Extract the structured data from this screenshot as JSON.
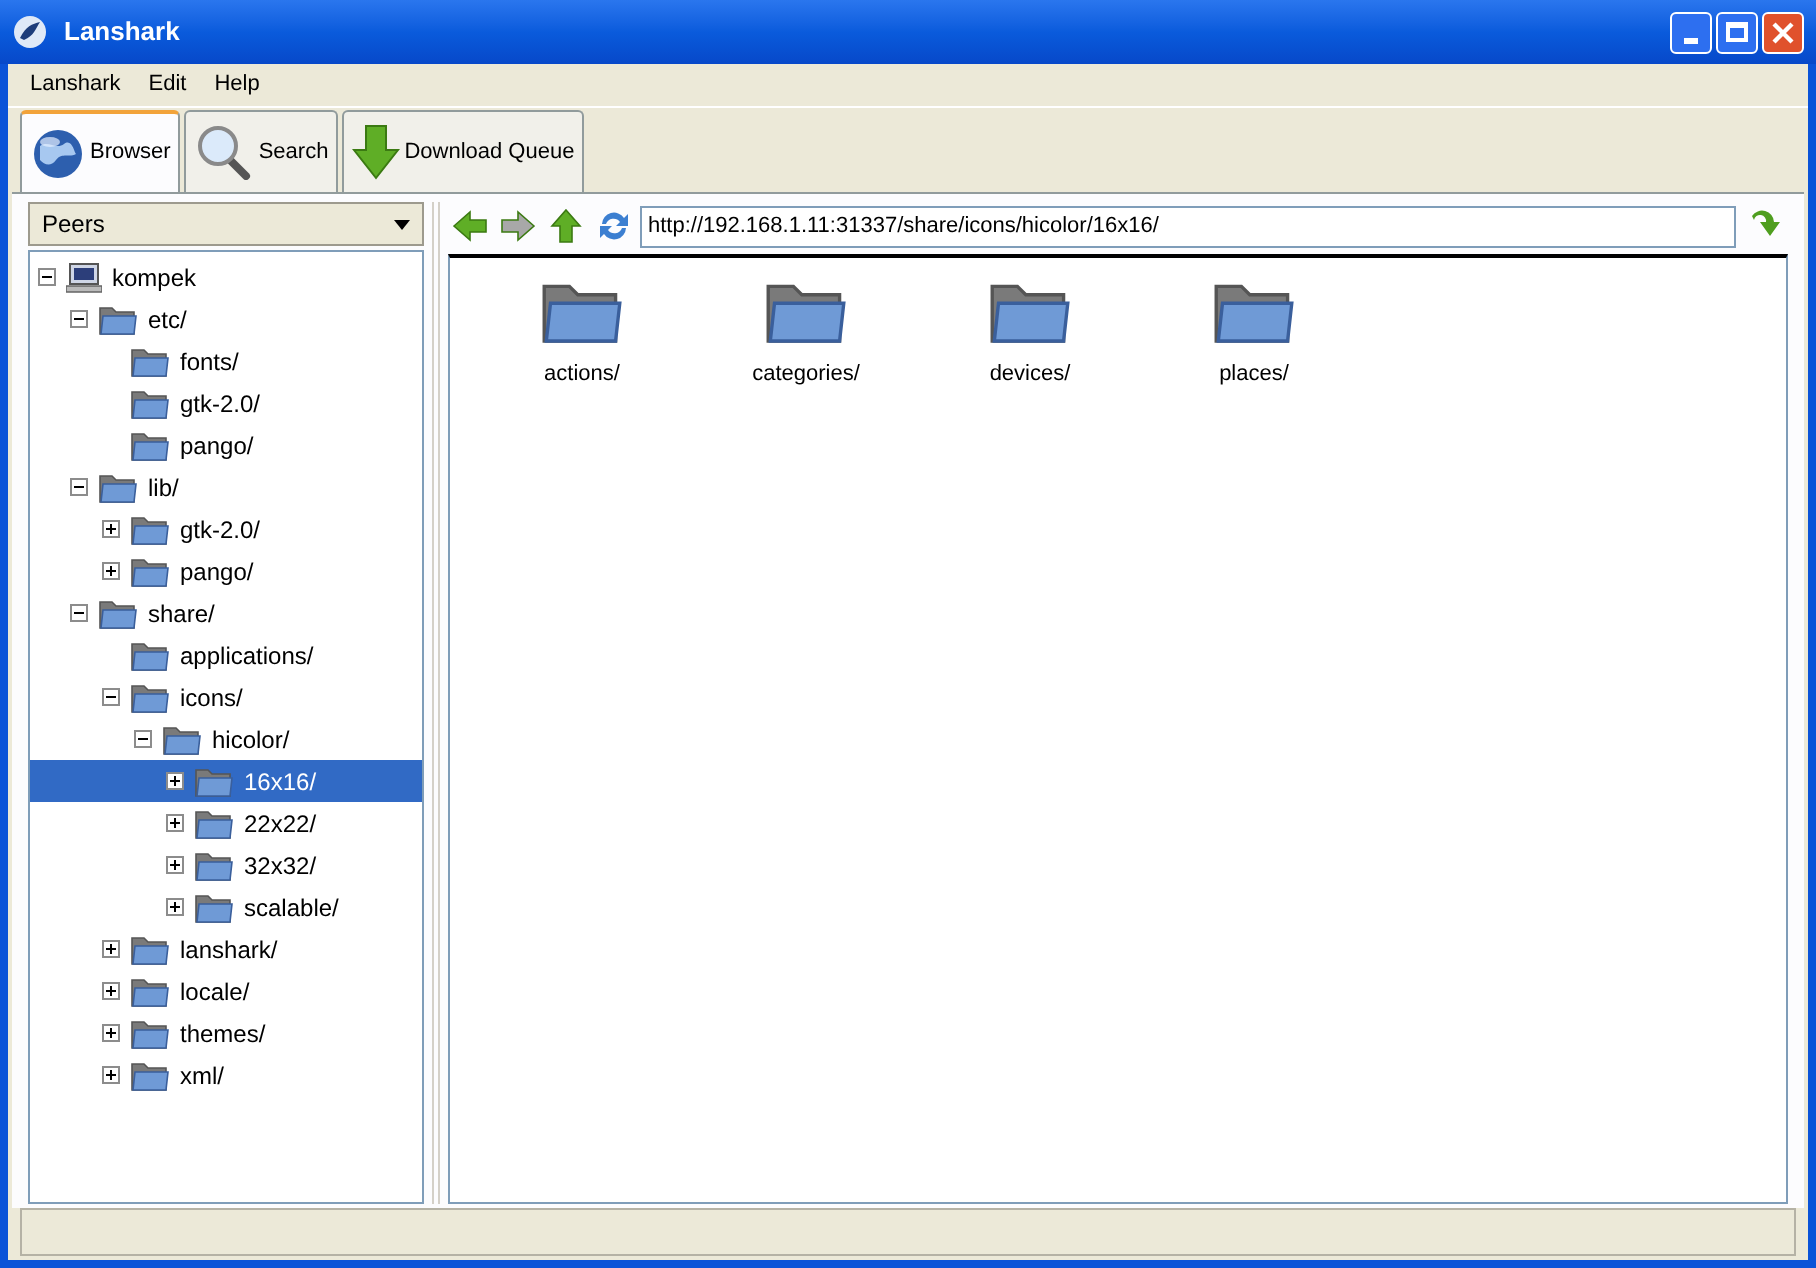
{
  "window": {
    "title": "Lanshark"
  },
  "menu": [
    "Lanshark",
    "Edit",
    "Help"
  ],
  "tabs": [
    {
      "label": "Browser",
      "selected": true
    },
    {
      "label": "Search",
      "selected": false
    },
    {
      "label": "Download Queue",
      "selected": false
    }
  ],
  "peers_dropdown": {
    "value": "Peers"
  },
  "address": {
    "value": "http://192.168.1.11:31337/share/icons/hicolor/16x16/"
  },
  "tree": [
    {
      "label": "kompek",
      "kind": "computer",
      "expanded": true,
      "selected": false,
      "children": [
        {
          "label": "etc/",
          "kind": "folder",
          "expanded": true,
          "selected": false,
          "children": [
            {
              "label": "fonts/",
              "kind": "folder",
              "selected": false
            },
            {
              "label": "gtk-2.0/",
              "kind": "folder",
              "selected": false
            },
            {
              "label": "pango/",
              "kind": "folder",
              "selected": false
            }
          ]
        },
        {
          "label": "lib/",
          "kind": "folder",
          "expanded": true,
          "selected": false,
          "children": [
            {
              "label": "gtk-2.0/",
              "kind": "folder",
              "expanded": false,
              "selected": false
            },
            {
              "label": "pango/",
              "kind": "folder",
              "expanded": false,
              "selected": false
            }
          ]
        },
        {
          "label": "share/",
          "kind": "folder",
          "expanded": true,
          "selected": false,
          "children": [
            {
              "label": "applications/",
              "kind": "folder",
              "selected": false
            },
            {
              "label": "icons/",
              "kind": "folder",
              "expanded": true,
              "selected": false,
              "children": [
                {
                  "label": "hicolor/",
                  "kind": "folder",
                  "expanded": true,
                  "selected": false,
                  "children": [
                    {
                      "label": "16x16/",
                      "kind": "folder",
                      "expanded": false,
                      "selected": true
                    },
                    {
                      "label": "22x22/",
                      "kind": "folder",
                      "expanded": false,
                      "selected": false
                    },
                    {
                      "label": "32x32/",
                      "kind": "folder",
                      "expanded": false,
                      "selected": false
                    },
                    {
                      "label": "scalable/",
                      "kind": "folder",
                      "expanded": false,
                      "selected": false
                    }
                  ]
                }
              ]
            },
            {
              "label": "lanshark/",
              "kind": "folder",
              "expanded": false,
              "selected": false
            },
            {
              "label": "locale/",
              "kind": "folder",
              "expanded": false,
              "selected": false
            },
            {
              "label": "themes/",
              "kind": "folder",
              "expanded": false,
              "selected": false
            },
            {
              "label": "xml/",
              "kind": "folder",
              "expanded": false,
              "selected": false
            }
          ]
        }
      ]
    }
  ],
  "files": [
    {
      "label": "actions/"
    },
    {
      "label": "categories/"
    },
    {
      "label": "devices/"
    },
    {
      "label": "places/"
    }
  ]
}
